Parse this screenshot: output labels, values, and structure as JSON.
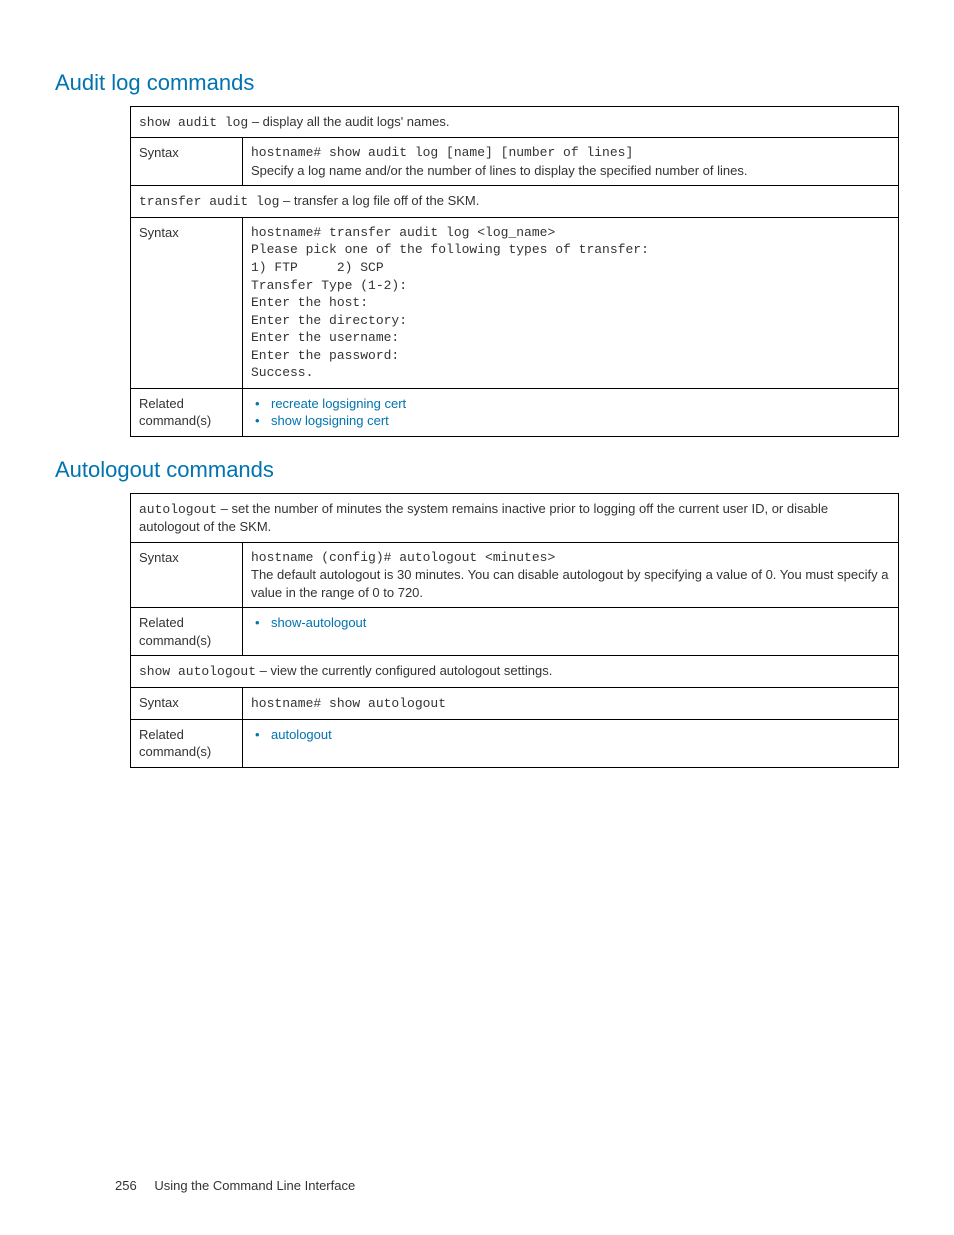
{
  "sections": {
    "audit": {
      "heading": "Audit log commands",
      "row1_cmd": "show audit log",
      "row1_desc": " – display all the audit logs' names.",
      "row2_label": "Syntax",
      "row2_code": "hostname# show audit log [name] [number of lines]",
      "row2_text": "Specify a log name and/or the number of lines to display the specified number of lines.",
      "row3_cmd": "transfer audit log",
      "row3_desc": " – transfer a log file off of the SKM.",
      "row4_label": "Syntax",
      "row4_code": "hostname# transfer audit log <log_name>\nPlease pick one of the following types of transfer:\n1) FTP     2) SCP\nTransfer Type (1-2):\nEnter the host:\nEnter the directory:\nEnter the username:\nEnter the password:\nSuccess.",
      "row5_label": "Related command(s)",
      "row5_link1": "recreate logsigning cert",
      "row5_link2": "show logsigning cert"
    },
    "autologout": {
      "heading": "Autologout commands",
      "row1_cmd": "autologout",
      "row1_desc": " – set the number of minutes the system remains inactive prior to logging off the current user ID, or disable autologout of the SKM.",
      "row2_label": "Syntax",
      "row2_code": "hostname (config)# autologout <minutes>",
      "row2_text": "The default autologout is 30 minutes.  You can disable autologout by specifying a value of 0.  You must specify a value in the range of 0 to 720.",
      "row3_label": "Related command(s)",
      "row3_link1": "show-autologout",
      "row4_cmd": "show autologout",
      "row4_desc": " – view the currently configured autologout settings.",
      "row5_label": "Syntax",
      "row5_code": "hostname# show autologout",
      "row6_label": "Related command(s)",
      "row6_link1": "autologout"
    }
  },
  "footer": {
    "page": "256",
    "title": "Using the Command Line Interface"
  }
}
